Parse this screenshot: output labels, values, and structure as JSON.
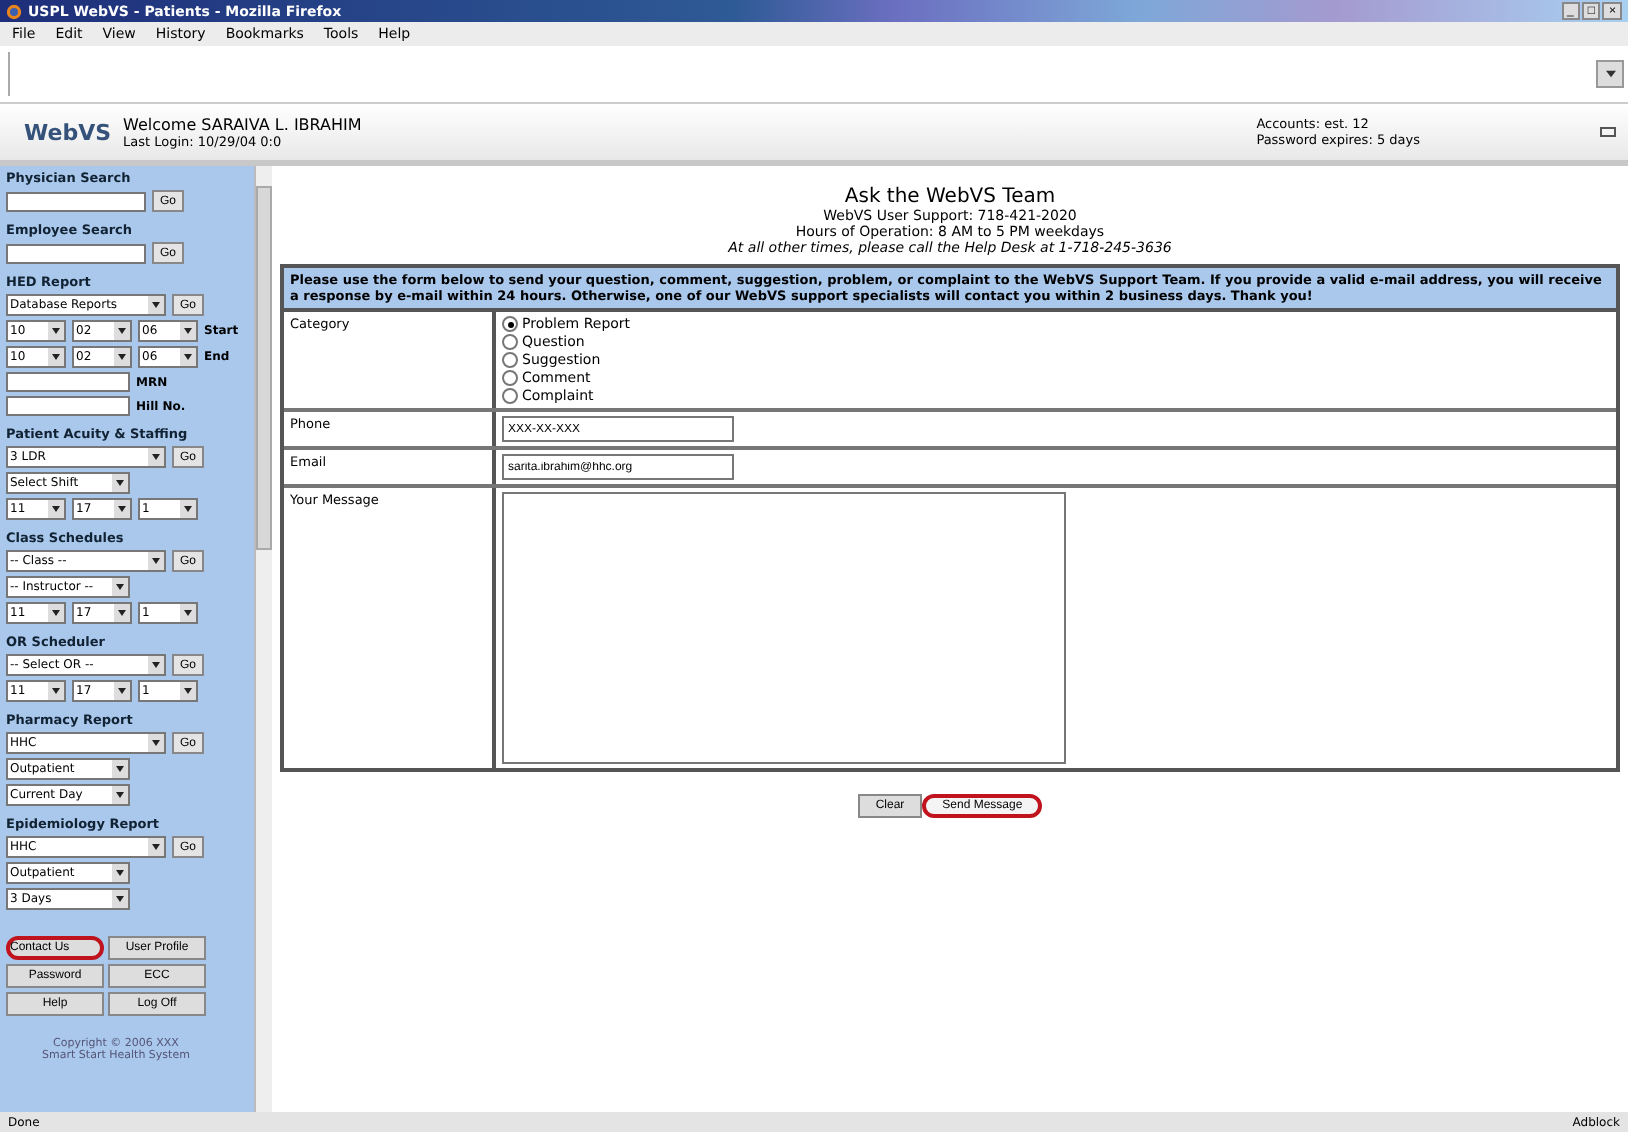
{
  "window": {
    "title": "USPL WebVS - Patients - Mozilla Firefox",
    "controls": [
      "_",
      "□",
      "×"
    ]
  },
  "menu": [
    "File",
    "Edit",
    "View",
    "History",
    "Bookmarks",
    "Tools",
    "Help"
  ],
  "header": {
    "logo": "WebVS",
    "welcome": "Welcome SARAIVA L. IBRAHIM",
    "last_login": "Last Login: 10/29/04 0:0",
    "account": "Accounts: est. 12",
    "password_note": "Password expires: 5 days"
  },
  "sidebar": {
    "sections": [
      {
        "title": "Physician Search",
        "rows": [
          {
            "controls": [
              {
                "kind": "input"
              },
              {
                "kind": "button",
                "label": "Go"
              }
            ]
          }
        ]
      },
      {
        "title": "Employee Search",
        "rows": [
          {
            "controls": [
              {
                "kind": "input"
              },
              {
                "kind": "button",
                "label": "Go"
              }
            ]
          }
        ]
      },
      {
        "title": "HED Report",
        "rows": [
          {
            "controls": [
              {
                "kind": "select",
                "value": "Database Reports"
              },
              {
                "kind": "button",
                "label": "Go"
              }
            ]
          },
          {
            "controls": [
              {
                "kind": "select",
                "value": "10"
              },
              {
                "kind": "select",
                "value": "02"
              },
              {
                "kind": "select",
                "value": "06"
              },
              {
                "kind": "label",
                "text": "Start"
              }
            ]
          },
          {
            "controls": [
              {
                "kind": "select",
                "value": "10"
              },
              {
                "kind": "select",
                "value": "02"
              },
              {
                "kind": "select",
                "value": "06"
              },
              {
                "kind": "label",
                "text": "End"
              }
            ]
          },
          {
            "controls": [
              {
                "kind": "input"
              },
              {
                "kind": "label",
                "text": "MRN"
              }
            ]
          },
          {
            "controls": [
              {
                "kind": "input"
              },
              {
                "kind": "label",
                "text": "Hill No."
              }
            ]
          }
        ]
      },
      {
        "title": "Patient Acuity & Staffing",
        "rows": [
          {
            "controls": [
              {
                "kind": "select",
                "value": "3 LDR"
              },
              {
                "kind": "button",
                "label": "Go"
              }
            ]
          },
          {
            "controls": [
              {
                "kind": "select",
                "value": "Select Shift"
              }
            ]
          },
          {
            "controls": [
              {
                "kind": "select",
                "value": "11"
              },
              {
                "kind": "select",
                "value": "17"
              },
              {
                "kind": "select",
                "value": "1"
              }
            ]
          }
        ]
      },
      {
        "title": "Class Schedules",
        "rows": [
          {
            "controls": [
              {
                "kind": "select",
                "value": "-- Class --"
              },
              {
                "kind": "button",
                "label": "Go"
              }
            ]
          },
          {
            "controls": [
              {
                "kind": "select",
                "value": "-- Instructor --"
              }
            ]
          },
          {
            "controls": [
              {
                "kind": "select",
                "value": "11"
              },
              {
                "kind": "select",
                "value": "17"
              },
              {
                "kind": "select",
                "value": "1"
              }
            ]
          }
        ]
      },
      {
        "title": "OR Scheduler",
        "rows": [
          {
            "controls": [
              {
                "kind": "select",
                "value": "-- Select OR --"
              },
              {
                "kind": "button",
                "label": "Go"
              }
            ]
          },
          {
            "controls": [
              {
                "kind": "select",
                "value": "11"
              },
              {
                "kind": "select",
                "value": "17"
              },
              {
                "kind": "select",
                "value": "1"
              }
            ]
          }
        ]
      },
      {
        "title": "Pharmacy Report",
        "rows": [
          {
            "controls": [
              {
                "kind": "select",
                "value": "HHC"
              },
              {
                "kind": "button",
                "label": "Go"
              }
            ]
          },
          {
            "controls": [
              {
                "kind": "select",
                "value": "Outpatient"
              }
            ]
          },
          {
            "controls": [
              {
                "kind": "select",
                "value": "Current Day"
              }
            ]
          }
        ]
      },
      {
        "title": "Epidemiology Report",
        "rows": [
          {
            "controls": [
              {
                "kind": "select",
                "value": "HHC"
              },
              {
                "kind": "button",
                "label": "Go"
              }
            ]
          },
          {
            "controls": [
              {
                "kind": "select",
                "value": "Outpatient"
              }
            ]
          },
          {
            "controls": [
              {
                "kind": "select",
                "value": "3 Days"
              }
            ]
          }
        ]
      }
    ],
    "buttons": [
      {
        "label": "Contact Us",
        "highlighted": true
      },
      {
        "label": "User Profile",
        "highlighted": false
      },
      {
        "label": "Password",
        "highlighted": false
      },
      {
        "label": "ECC",
        "highlighted": false
      },
      {
        "label": "Help",
        "highlighted": false
      },
      {
        "label": "Log Off",
        "highlighted": false
      }
    ],
    "copyright": [
      "Copyright © 2006 XXX",
      "Smart Start Health System"
    ]
  },
  "main": {
    "title": "Ask the WebVS Team",
    "support": "WebVS User Support: 718-421-2020",
    "hours": "Hours of Operation: 8 AM to 5 PM weekdays",
    "after_hours": "At all other times, please call the Help Desk at 1-718-245-3636",
    "intro": "Please use the form below to send your question, comment, suggestion, problem, or complaint to the WebVS Support Team. If you provide a valid e-mail address, you will receive a response by e-mail within 24 hours. Otherwise, one of our WebVS support specialists will contact you within 2 business days. Thank you!",
    "category": {
      "label": "Category",
      "options": [
        {
          "label": "Problem Report",
          "selected": true
        },
        {
          "label": "Question",
          "selected": false
        },
        {
          "label": "Suggestion",
          "selected": false
        },
        {
          "label": "Comment",
          "selected": false
        },
        {
          "label": "Complaint",
          "selected": false
        }
      ]
    },
    "phone": {
      "label": "Phone",
      "value": "XXX-XX-XXX"
    },
    "email": {
      "label": "Email",
      "value": "sarita.ibrahim@hhc.org"
    },
    "message": {
      "label": "Your Message"
    },
    "buttons": [
      {
        "label": "Clear",
        "highlighted": false
      },
      {
        "label": "Send Message",
        "highlighted": true
      }
    ]
  },
  "status_bar": {
    "left": "Done",
    "right": "Adblock"
  }
}
